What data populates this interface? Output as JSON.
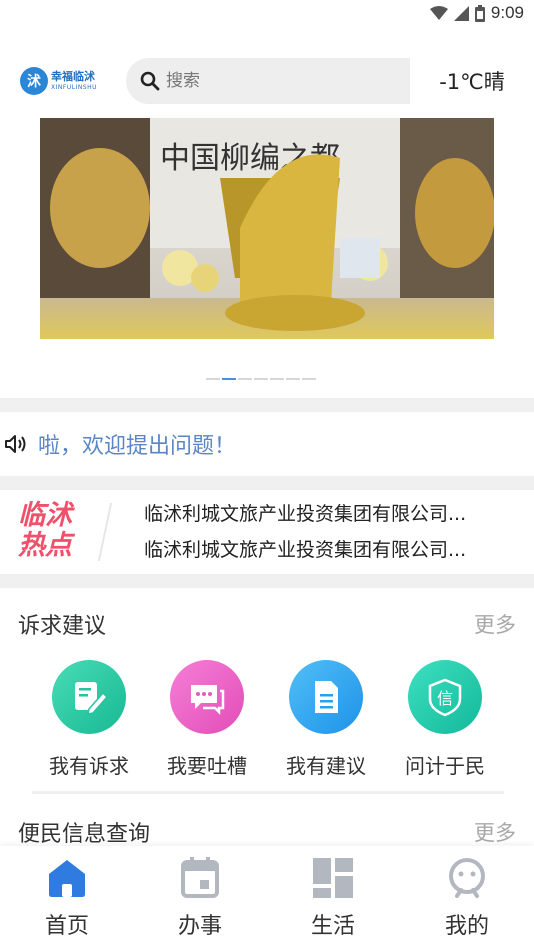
{
  "status_bar": {
    "time": "9:09"
  },
  "header": {
    "logo_text": "幸福临沭",
    "logo_sub": "XINFULINSHU",
    "search_placeholder": "搜索",
    "weather": "-1℃晴"
  },
  "banner": {
    "slide_count": 7,
    "active_index": 1
  },
  "notice": {
    "text": "啦，欢迎提出问题！"
  },
  "hot_news": {
    "logo_line1": "临沭",
    "logo_line2": "热点",
    "items": [
      "临沭利城文旅产业投资集团有限公司...",
      "临沭利城文旅产业投资集团有限公司..."
    ]
  },
  "appeal_section": {
    "title": "诉求建议",
    "more": "更多",
    "items": [
      {
        "label": "我有诉求",
        "icon": "edit-icon",
        "color": "#2fc9a4"
      },
      {
        "label": "我要吐槽",
        "icon": "chat-icon",
        "color": "#ee5ec3"
      },
      {
        "label": "我有建议",
        "icon": "document-icon",
        "color": "#2fa6f0"
      },
      {
        "label": "问计于民",
        "icon": "xin-badge-icon",
        "color": "#1fc7a9"
      }
    ]
  },
  "info_section": {
    "title": "便民信息查询",
    "more": "更多"
  },
  "bottom_nav": {
    "items": [
      {
        "label": "首页",
        "icon": "home-icon",
        "active": true
      },
      {
        "label": "办事",
        "icon": "calendar-icon",
        "active": false
      },
      {
        "label": "生活",
        "icon": "grid-icon",
        "active": false
      },
      {
        "label": "我的",
        "icon": "user-icon",
        "active": false
      }
    ],
    "active_color": "#2f7bdf",
    "inactive_color": "#b3b7bf"
  }
}
